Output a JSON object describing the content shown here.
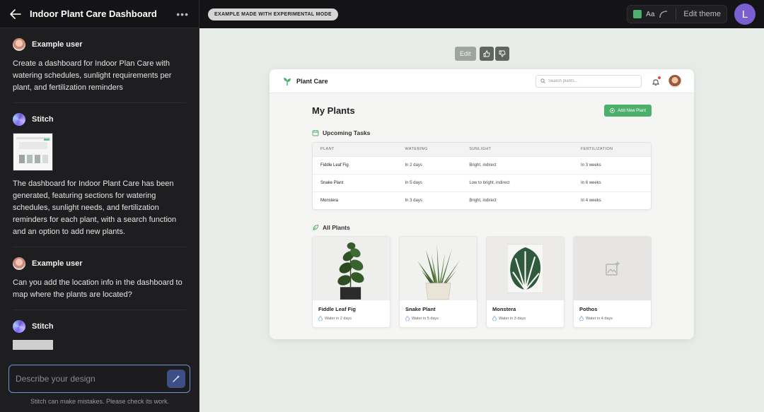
{
  "left_panel": {
    "title": "Indoor Plant Care Dashboard",
    "messages": [
      {
        "author": "Example user",
        "text": "Create a dashboard for Indoor Plan Care with watering schedules, sunlight requirements per plant, and fertilization reminders"
      },
      {
        "author": "Stitch",
        "text": "The dashboard for Indoor Plant Care has been generated, featuring sections for watering schedules, sunlight needs, and fertilization reminders for each plant, with a search function and an option to add new plants."
      },
      {
        "author": "Example user",
        "text": "Can you add the location info in the dashboard to map where the plants are located?"
      },
      {
        "author": "Stitch",
        "text": ""
      }
    ],
    "composer_placeholder": "Describe your design",
    "disclaimer": "Stitch can make mistakes. Please check its work."
  },
  "topbar": {
    "badge": "EXAMPLE MADE WITH EXPERIMENTAL MODE",
    "font_label": "Aa",
    "edit_theme": "Edit theme",
    "profile_initial": "L",
    "accent_color": "#4caf6c"
  },
  "canvas_tools": {
    "edit_label": "Edit"
  },
  "app": {
    "brand": "Plant Care",
    "search_placeholder": "Search plants...",
    "page_title": "My Plants",
    "add_button": "Add New Plant",
    "upcoming_title": "Upcoming Tasks",
    "table_headers": [
      "PLANT",
      "WATERING",
      "SUNLIGHT",
      "FERTILIZATION"
    ],
    "tasks": [
      {
        "plant": "Fiddle Leaf Fig",
        "watering": "In 2 days",
        "sunlight": "Bright, indirect",
        "fertilization": "In 3 weeks"
      },
      {
        "plant": "Snake Plant",
        "watering": "In 5 days",
        "sunlight": "Low to bright, indirect",
        "fertilization": "In 6 weeks"
      },
      {
        "plant": "Monstera",
        "watering": "In 3 days",
        "sunlight": "Bright, indirect",
        "fertilization": "In 4 weeks"
      }
    ],
    "all_plants_title": "All Plants",
    "plants": [
      {
        "name": "Fiddle Leaf Fig",
        "water": "Water in 2 days"
      },
      {
        "name": "Snake Plant",
        "water": "Water in 5 days"
      },
      {
        "name": "Monstera",
        "water": "Water in 3 days"
      },
      {
        "name": "Pothos",
        "water": "Water in 4 days"
      }
    ]
  }
}
